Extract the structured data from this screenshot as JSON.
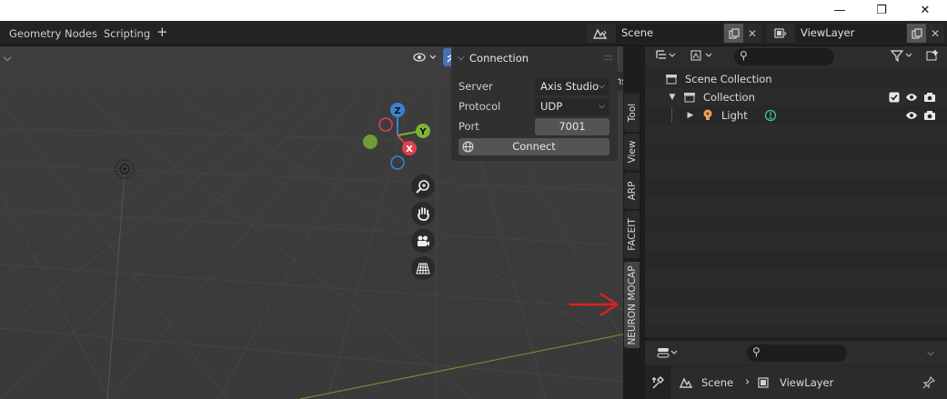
{
  "window": {
    "minimize": "—",
    "maximize": "❐",
    "close": "✕"
  },
  "workspaces": {
    "tabs": [
      "Geometry Nodes",
      "Scripting"
    ],
    "add": "+"
  },
  "scene_selector": {
    "value": "Scene"
  },
  "viewlayer_selector": {
    "value": "ViewLayer"
  },
  "viewport": {
    "options_label": "Options",
    "gizmo": {
      "z": "Z",
      "y": "Y",
      "x": "X"
    }
  },
  "npanel": {
    "title": "Connection",
    "server_label": "Server",
    "server_value": "Axis Studio",
    "protocol_label": "Protocol",
    "protocol_value": "UDP",
    "port_label": "Port",
    "port_value": "7001",
    "connect_label": "Connect"
  },
  "sidebar_tabs": [
    "Tool",
    "View",
    "ARP",
    "FACEIT",
    "NEURON MOCAP"
  ],
  "outliner": {
    "scene_collection": "Scene Collection",
    "collection": "Collection",
    "light": "Light"
  },
  "properties": {
    "breadcrumb_scene": "Scene",
    "breadcrumb_viewlayer": "ViewLayer"
  },
  "colors": {
    "accent": "#4772b3",
    "annotation_arrow": "#e02020",
    "light_icon": "#e8a05a",
    "axis_x": "#e04050",
    "axis_y": "#7cb332",
    "axis_z": "#3b82d6"
  }
}
